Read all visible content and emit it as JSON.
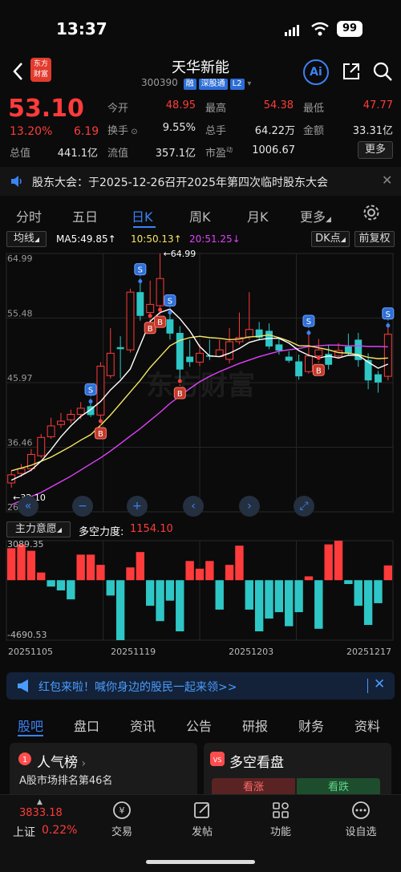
{
  "status_bar": {
    "time": "13:37",
    "battery": "99"
  },
  "header": {
    "name": "天华新能",
    "code": "300390",
    "tags": [
      "融",
      "深股通",
      "L2"
    ],
    "logo_text": "东方财富",
    "ai_label": "Ai"
  },
  "quote": {
    "price": "53.10",
    "change_pct": "13.20%",
    "change": "6.19",
    "fields": [
      {
        "label": "今开",
        "value": "48.95",
        "color": "#ff3b3b"
      },
      {
        "label": "最高",
        "value": "54.38",
        "color": "#ff3b3b"
      },
      {
        "label": "最低",
        "value": "47.77",
        "color": "#ff3b3b"
      },
      {
        "label": "换手",
        "value": "9.55%",
        "color": "#e6e6e6"
      },
      {
        "label": "总手",
        "value": "64.22万",
        "color": "#e6e6e6"
      },
      {
        "label": "金额",
        "value": "33.31亿",
        "color": "#e6e6e6"
      },
      {
        "label": "总值",
        "value": "441.1亿",
        "color": "#e6e6e6"
      },
      {
        "label": "流值",
        "value": "357.1亿",
        "color": "#e6e6e6"
      },
      {
        "label": "市盈",
        "sup": "动",
        "value": "1006.67",
        "color": "#e6e6e6"
      }
    ],
    "more_label": "更多"
  },
  "notice": {
    "text": "股东大会：于2025-12-26召开2025年第四次临时股东大会"
  },
  "kline_tabs": [
    "分时",
    "五日",
    "日K",
    "周K",
    "月K",
    "更多"
  ],
  "kline_active": 2,
  "chart_toolbar": {
    "indicator": "均线",
    "ma5": "MA5:49.85↑",
    "ma10": "10:50.13↑",
    "ma20": "20:51.25↓",
    "dk_button": "DK点",
    "adjust_button": "前复权"
  },
  "colors": {
    "up": "#ff3b3b",
    "down": "#2fc6c6",
    "ma5": "#ffffff",
    "ma10": "#f5e663",
    "ma20": "#e040fb",
    "accent": "#3b82f6"
  },
  "chart_data": {
    "type": "candlestick",
    "y_ticks": [
      "64.99",
      "55.48",
      "45.97",
      "36.46",
      "26.95"
    ],
    "ylim": [
      26.95,
      64.99
    ],
    "high_marker": "←64.99",
    "low_marker": "←32.10",
    "x_labels": [
      "20251105",
      "20251119",
      "20251203",
      "20251217"
    ],
    "candles": [
      {
        "o": 31.2,
        "c": 32.4,
        "h": 33.0,
        "l": 30.5
      },
      {
        "o": 32.6,
        "c": 33.3,
        "h": 34.0,
        "l": 32.1
      },
      {
        "o": 33.3,
        "c": 35.4,
        "h": 36.2,
        "l": 32.9
      },
      {
        "o": 35.2,
        "c": 37.9,
        "h": 38.4,
        "l": 34.9
      },
      {
        "o": 38.0,
        "c": 39.6,
        "h": 40.8,
        "l": 37.7
      },
      {
        "o": 39.8,
        "c": 40.3,
        "h": 41.5,
        "l": 39.3
      },
      {
        "o": 40.5,
        "c": 41.3,
        "h": 42.0,
        "l": 40.0
      },
      {
        "o": 41.3,
        "c": 42.2,
        "h": 43.1,
        "l": 40.6
      },
      {
        "o": 42.5,
        "c": 41.2,
        "h": 43.2,
        "l": 40.9
      },
      {
        "o": 41.2,
        "c": 48.4,
        "h": 49.0,
        "l": 40.3
      },
      {
        "o": 47.0,
        "c": 50.3,
        "h": 54.0,
        "l": 46.6
      },
      {
        "o": 51.2,
        "c": 50.9,
        "h": 52.8,
        "l": 46.6
      },
      {
        "o": 50.8,
        "c": 59.3,
        "h": 59.8,
        "l": 50.4
      },
      {
        "o": 59.3,
        "c": 55.8,
        "h": 60.9,
        "l": 55.1
      },
      {
        "o": 56.3,
        "c": 57.5,
        "h": 61.0,
        "l": 55.8
      },
      {
        "o": 57.3,
        "c": 61.3,
        "h": 64.99,
        "l": 56.7
      },
      {
        "o": 55.3,
        "c": 53.2,
        "h": 56.3,
        "l": 52.3
      },
      {
        "o": 53.3,
        "c": 47.9,
        "h": 54.3,
        "l": 46.2
      },
      {
        "o": 49.8,
        "c": 49.0,
        "h": 52.3,
        "l": 48.3
      },
      {
        "o": 49.0,
        "c": 50.3,
        "h": 51.6,
        "l": 48.4
      },
      {
        "o": 50.0,
        "c": 49.8,
        "h": 52.3,
        "l": 49.3
      },
      {
        "o": 49.8,
        "c": 50.8,
        "h": 52.3,
        "l": 49.8
      },
      {
        "o": 49.4,
        "c": 52.0,
        "h": 54.0,
        "l": 48.8
      },
      {
        "o": 52.0,
        "c": 52.6,
        "h": 56.3,
        "l": 51.6
      },
      {
        "o": 52.7,
        "c": 53.8,
        "h": 59.3,
        "l": 52.3
      },
      {
        "o": 53.8,
        "c": 52.6,
        "h": 54.9,
        "l": 52.2
      },
      {
        "o": 53.6,
        "c": 51.3,
        "h": 54.7,
        "l": 50.9
      },
      {
        "o": 51.6,
        "c": 50.7,
        "h": 52.6,
        "l": 50.1
      },
      {
        "o": 49.8,
        "c": 49.2,
        "h": 50.6,
        "l": 48.9
      },
      {
        "o": 49.1,
        "c": 46.9,
        "h": 50.1,
        "l": 46.4
      },
      {
        "o": 47.6,
        "c": 49.9,
        "h": 53.3,
        "l": 47.3
      },
      {
        "o": 49.9,
        "c": 50.8,
        "h": 52.4,
        "l": 49.6
      },
      {
        "o": 50.2,
        "c": 48.6,
        "h": 51.6,
        "l": 47.9
      },
      {
        "o": 49.9,
        "c": 50.7,
        "h": 51.8,
        "l": 49.6
      },
      {
        "o": 51.3,
        "c": 50.3,
        "h": 53.2,
        "l": 49.9
      },
      {
        "o": 52.3,
        "c": 49.3,
        "h": 53.3,
        "l": 48.3
      },
      {
        "o": 49.3,
        "c": 46.3,
        "h": 50.3,
        "l": 45.0
      },
      {
        "o": 47.2,
        "c": 46.0,
        "h": 47.7,
        "l": 44.5
      },
      {
        "o": 46.9,
        "c": 53.1,
        "h": 54.38,
        "l": 46.3
      }
    ],
    "ma5": [
      31.6,
      32.3,
      33.1,
      34.4,
      36.1,
      38.0,
      39.6,
      41.0,
      42.0,
      43.2,
      44.9,
      46.3,
      48.0,
      51.5,
      55.0,
      56.3,
      56.8,
      55.4,
      53.6,
      51.3,
      49.9,
      49.8,
      50.3,
      51.0,
      51.9,
      52.3,
      52.5,
      52.5,
      51.8,
      50.7,
      50.0,
      49.6,
      49.9,
      49.6,
      50.0,
      50.0,
      49.0,
      48.1,
      48.7
    ],
    "ma10": [
      33.0,
      33.4,
      33.8,
      34.4,
      35.0,
      35.8,
      36.6,
      37.5,
      38.3,
      39.7,
      41.2,
      42.9,
      44.6,
      46.3,
      48.2,
      49.8,
      51.4,
      52.2,
      52.6,
      52.8,
      52.6,
      52.5,
      52.3,
      52.4,
      52.7,
      52.8,
      53.0,
      52.6,
      52.1,
      51.4,
      51.4,
      51.1,
      50.8,
      50.4,
      50.3,
      50.1,
      49.7,
      49.5,
      49.6
    ],
    "ma20": [
      28.0,
      28.6,
      29.2,
      29.8,
      30.6,
      31.4,
      32.2,
      33.1,
      34.0,
      34.9,
      35.9,
      37.0,
      38.1,
      39.2,
      40.4,
      41.6,
      42.9,
      44.0,
      45.1,
      46.1,
      46.9,
      47.6,
      48.2,
      48.8,
      49.3,
      49.8,
      50.2,
      50.6,
      50.8,
      51.0,
      51.3,
      51.4,
      51.5,
      51.5,
      51.4,
      51.4,
      51.3,
      51.3,
      51.25
    ],
    "signals": [
      {
        "index": 8,
        "type": "S"
      },
      {
        "index": 9,
        "type": "B"
      },
      {
        "index": 13,
        "type": "S"
      },
      {
        "index": 14,
        "type": "B"
      },
      {
        "index": 15,
        "type": "B"
      },
      {
        "index": 16,
        "type": "S"
      },
      {
        "index": 17,
        "type": "B"
      },
      {
        "index": 30,
        "type": "S"
      },
      {
        "index": 31,
        "type": "B"
      },
      {
        "index": 38,
        "type": "S"
      }
    ],
    "sub": {
      "indicator": "主力意愿",
      "name": "多空力度:",
      "value": "1154.10",
      "y_top": "3089.35",
      "y_bottom": "-4690.53",
      "ylim": [
        -4690.53,
        3089.35
      ],
      "bars": [
        2500,
        2800,
        2300,
        600,
        -500,
        -800,
        -1500,
        2000,
        2000,
        1200,
        -1200,
        -4690,
        1000,
        2200,
        -2000,
        -3200,
        -1600,
        -4000,
        1500,
        900,
        1500,
        -2300,
        1200,
        2700,
        -2300,
        -4000,
        -3000,
        -2500,
        -3600,
        -2500,
        300,
        -3800,
        2800,
        3089,
        -300,
        -2000,
        -3500,
        -1800,
        1154
      ]
    }
  },
  "chart_controls": [
    "«",
    "−",
    "+",
    "‹",
    "›",
    "⤢"
  ],
  "banner": {
    "text": "红包来啦！喊你身边的股民一起来领>>"
  },
  "bottom_tabs": [
    "股吧",
    "盘口",
    "资讯",
    "公告",
    "研报",
    "财务",
    "资料"
  ],
  "cards": {
    "popular_title": "人气榜",
    "popular_rank": "A股市场排名第46名",
    "duokong_title": "多空看盘",
    "bull_label": "看涨",
    "bear_label": "看跌"
  },
  "bottom_nav": {
    "index_value": "3833.18",
    "index_name": "上证",
    "index_pct": "0.22%",
    "items": [
      {
        "label": "交易",
        "icon": "yuan-icon"
      },
      {
        "label": "发帖",
        "icon": "edit-icon"
      },
      {
        "label": "功能",
        "icon": "grid-icon"
      },
      {
        "label": "设自选",
        "icon": "more-icon"
      }
    ]
  }
}
